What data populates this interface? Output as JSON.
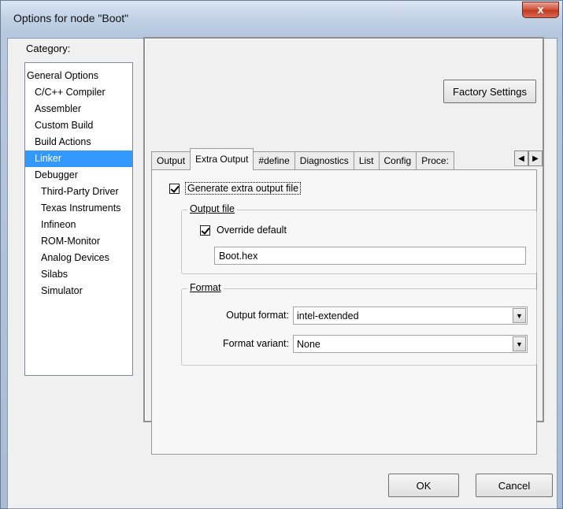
{
  "window": {
    "title": "Options for node \"Boot\"",
    "close_glyph": "x"
  },
  "category": {
    "label": "Category:",
    "items": [
      {
        "label": "General Options",
        "level": 0,
        "selected": false
      },
      {
        "label": "C/C++ Compiler",
        "level": 1,
        "selected": false
      },
      {
        "label": "Assembler",
        "level": 1,
        "selected": false
      },
      {
        "label": "Custom Build",
        "level": 1,
        "selected": false
      },
      {
        "label": "Build Actions",
        "level": 1,
        "selected": false
      },
      {
        "label": "Linker",
        "level": 1,
        "selected": true
      },
      {
        "label": "Debugger",
        "level": 1,
        "selected": false
      },
      {
        "label": "Third-Party Driver",
        "level": 2,
        "selected": false
      },
      {
        "label": "Texas Instruments",
        "level": 2,
        "selected": false
      },
      {
        "label": "Infineon",
        "level": 2,
        "selected": false
      },
      {
        "label": "ROM-Monitor",
        "level": 2,
        "selected": false
      },
      {
        "label": "Analog Devices",
        "level": 2,
        "selected": false
      },
      {
        "label": "Silabs",
        "level": 2,
        "selected": false
      },
      {
        "label": "Simulator",
        "level": 2,
        "selected": false
      }
    ]
  },
  "factory_settings_label": "Factory Settings",
  "tabs": [
    "Output",
    "Extra Output",
    "#define",
    "Diagnostics",
    "List",
    "Config",
    "Proce:"
  ],
  "active_tab": "Extra Output",
  "tab_scroll": {
    "left": "◀",
    "right": "▶"
  },
  "extra_output": {
    "generate_label": "Generate extra output file",
    "generate_checked": true,
    "output_file_group": "Output file",
    "override_label": "Override default",
    "override_checked": true,
    "filename": "Boot.hex",
    "format_group": "Format",
    "output_format_label": "Output format:",
    "output_format_value": "intel-extended",
    "format_variant_label": "Format variant:",
    "format_variant_value": "None"
  },
  "buttons": {
    "ok": "OK",
    "cancel": "Cancel"
  }
}
